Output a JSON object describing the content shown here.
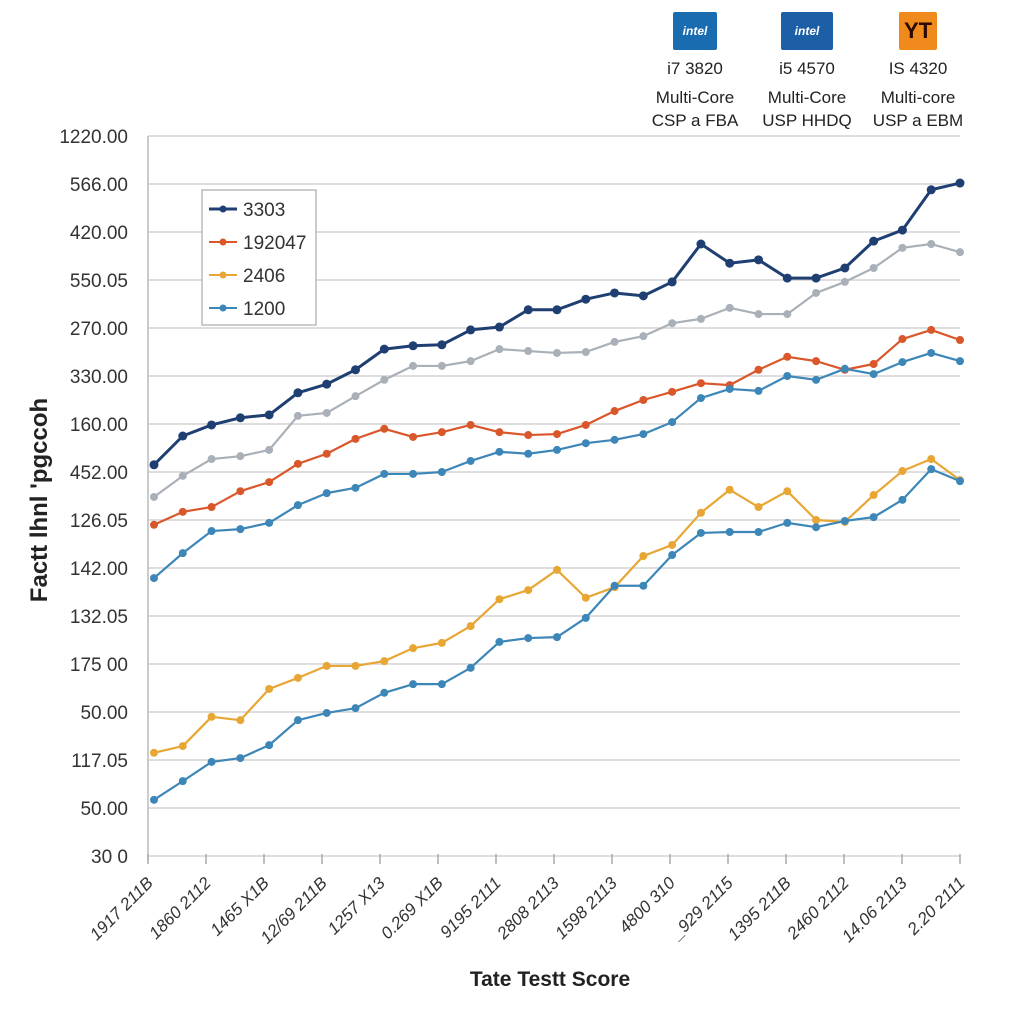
{
  "header": {
    "processors": [
      {
        "logo": "intel-logo",
        "logo_text": "intel",
        "color": "#1a6cb0",
        "name": "i7 3820",
        "line1": "Multi-Core",
        "line2": "CSP a FBA"
      },
      {
        "logo": "intel-inside-logo",
        "logo_text": "intel",
        "color": "#1d5fa6",
        "name": "i5 4570",
        "line1": "Multi-Core",
        "line2": "USP HHDQ"
      },
      {
        "logo": "yt-logo",
        "logo_text": "YT",
        "color": "#f08a1c",
        "name": "IS 4320",
        "line1": "Multi-core",
        "line2": "USP a EBM"
      }
    ]
  },
  "chart_data": {
    "type": "line",
    "title": "",
    "xlabel": "Tate Testt Score",
    "ylabel": "Factt lhnl 'pgccoh",
    "yticks": [
      "30  0",
      "50.00",
      "117.05",
      "50.00",
      "175 00",
      "132.05",
      "142.00",
      "126.05",
      "452.00",
      "160.00",
      "330.00",
      "270.00",
      "550.05",
      "420.00",
      "566.00",
      "1220.00"
    ],
    "xticks": [
      "1917 211B",
      "1860 2112",
      "1465 X1B",
      "12/69 211B",
      "1257 X13",
      "0.269 X1B",
      "9195 2111",
      "2808 2113",
      "1598 2113",
      "4800 310",
      "_929 2115",
      "1395 211B",
      "2460 2112",
      "14.06 2113",
      "2.20 2111"
    ],
    "y_unit_note": "values are expressed in gridline steps of the printed (non-monotonic) y tick labels, 0 = bottom tick",
    "ylim": [
      0,
      15
    ],
    "grid": true,
    "legend_position": "top-left",
    "series": [
      {
        "name": "3303",
        "color": "#1f3f73",
        "legend": true,
        "values": [
          8.15,
          8.75,
          8.98,
          9.13,
          9.19,
          9.65,
          9.83,
          10.13,
          10.56,
          10.63,
          10.65,
          10.96,
          11.02,
          11.38,
          11.38,
          11.6,
          11.73,
          11.67,
          11.96,
          12.75,
          12.35,
          12.42,
          12.04,
          12.04,
          12.25,
          12.81,
          13.04,
          13.88,
          14.02
        ]
      },
      {
        "color": "#a9b0b8",
        "legend": false,
        "values": [
          7.48,
          7.92,
          8.27,
          8.33,
          8.46,
          9.17,
          9.23,
          9.58,
          9.92,
          10.21,
          10.21,
          10.31,
          10.56,
          10.52,
          10.48,
          10.5,
          10.71,
          10.83,
          11.1,
          11.19,
          11.42,
          11.29,
          11.29,
          11.73,
          11.96,
          12.25,
          12.67,
          12.75,
          12.58
        ]
      },
      {
        "name": "192047",
        "color": "#d9572a",
        "legend": true,
        "values": [
          6.9,
          7.17,
          7.27,
          7.6,
          7.79,
          8.17,
          8.38,
          8.69,
          8.9,
          8.73,
          8.83,
          8.98,
          8.83,
          8.77,
          8.79,
          8.98,
          9.27,
          9.5,
          9.67,
          9.85,
          9.81,
          10.13,
          10.4,
          10.31,
          10.13,
          10.25,
          10.77,
          10.96,
          10.75
        ]
      },
      {
        "color": "#3d86b8",
        "legend": false,
        "values": [
          5.79,
          6.31,
          6.77,
          6.81,
          6.94,
          7.31,
          7.56,
          7.67,
          7.96,
          7.96,
          8.0,
          8.23,
          8.42,
          8.38,
          8.46,
          8.6,
          8.67,
          8.79,
          9.04,
          9.54,
          9.73,
          9.69,
          10.0,
          9.92,
          10.15,
          10.04,
          10.29,
          10.48,
          10.31
        ]
      },
      {
        "name": "2406",
        "color": "#e8a634",
        "legend": true,
        "values": [
          2.15,
          2.29,
          2.9,
          2.83,
          3.48,
          3.71,
          3.96,
          3.96,
          4.06,
          4.33,
          4.44,
          4.79,
          5.35,
          5.54,
          5.96,
          5.38,
          5.6,
          6.25,
          6.48,
          7.15,
          7.63,
          7.27,
          7.6,
          7.0,
          6.96,
          7.52,
          8.02,
          8.27,
          7.83
        ]
      },
      {
        "name": "1200",
        "color": "#3d86b8",
        "legend": true,
        "values": [
          1.17,
          1.56,
          1.96,
          2.04,
          2.31,
          2.83,
          2.98,
          3.08,
          3.4,
          3.58,
          3.58,
          3.92,
          4.46,
          4.54,
          4.56,
          4.96,
          5.63,
          5.63,
          6.27,
          6.73,
          6.75,
          6.75,
          6.94,
          6.85,
          6.98,
          7.06,
          7.42,
          8.06,
          7.81
        ]
      }
    ]
  }
}
